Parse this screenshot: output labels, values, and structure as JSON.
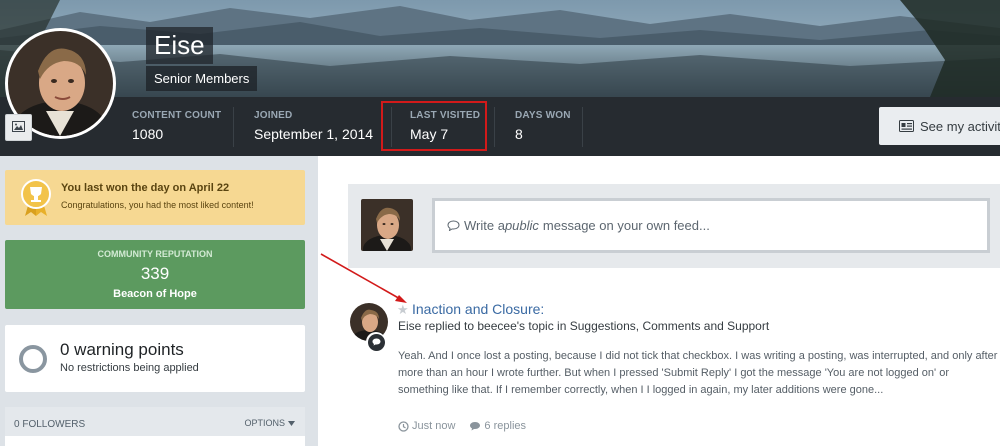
{
  "profile": {
    "name": "Eise",
    "group": "Senior Members"
  },
  "stats": [
    {
      "label": "CONTENT COUNT",
      "value": "1080"
    },
    {
      "label": "JOINED",
      "value": "September 1, 2014"
    },
    {
      "label": "LAST VISITED",
      "value": "May 7"
    },
    {
      "label": "DAYS WON",
      "value": "8"
    }
  ],
  "activity_button": {
    "label": "See my activity",
    "icon": "newspaper-icon"
  },
  "trophy": {
    "title": "You last won the day on April 22",
    "subtitle": "Congratulations, you had the most liked content!",
    "icon": "trophy-icon"
  },
  "reputation": {
    "label": "COMMUNITY REPUTATION",
    "value": "339",
    "title": "Beacon of Hope",
    "color": "#5c9a5f"
  },
  "warnings": {
    "title": "0 warning points",
    "subtitle": "No restrictions being applied"
  },
  "followers": {
    "label": "0 FOLLOWERS",
    "options": "OPTIONS"
  },
  "status": {
    "placeholder_pre": "Write a ",
    "placeholder_em": "public",
    "placeholder_post": " message on your own feed..."
  },
  "feed": {
    "title": "Inaction and Closure:",
    "meta": "Eise replied to beecee's topic in Suggestions, Comments and Support",
    "body": "Yeah. And I once lost a posting, because I did not tick that checkbox. I was writing a posting, was interrupted, and only after more than an hour I wrote further. But when I pressed 'Submit Reply' I got the message 'You are not logged on' or something like that. If I remember correctly, when I I logged in again, my later additions were gone...",
    "time": "Just now",
    "replies": "6 replies"
  },
  "colors": {
    "accent_link": "#3a6aa3",
    "highlight_border": "#d21a1a",
    "stat_bar": "#262b30"
  }
}
